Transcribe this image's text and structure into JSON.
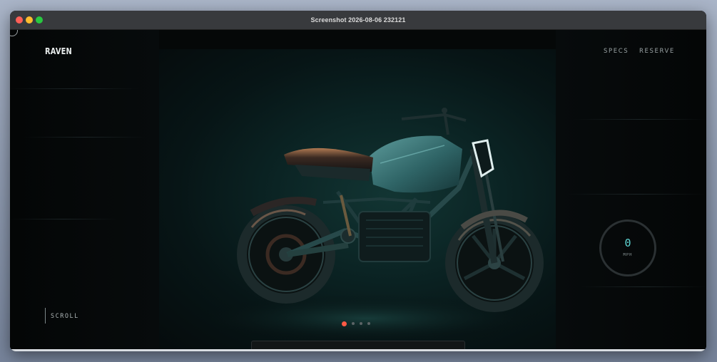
{
  "window": {
    "title": "Screenshot 2026-08-06 232121"
  },
  "site": {
    "logo": "RAVEN",
    "nav": [
      {
        "label": "SPECS"
      },
      {
        "label": "RESERVE"
      }
    ],
    "scroll_label": "SCROLL",
    "speed": {
      "value": "0",
      "unit": "MPH"
    },
    "carousel": {
      "count": 4,
      "active_index": 0
    }
  },
  "colors": {
    "accent": "#ff5a45",
    "speed_value": "#5fd6d4",
    "background": "#050808",
    "hero_teal": "#123533"
  },
  "icons": {
    "window_close": "close-traffic-light",
    "window_minimize": "minimize-traffic-light",
    "window_maximize": "maximize-traffic-light"
  }
}
